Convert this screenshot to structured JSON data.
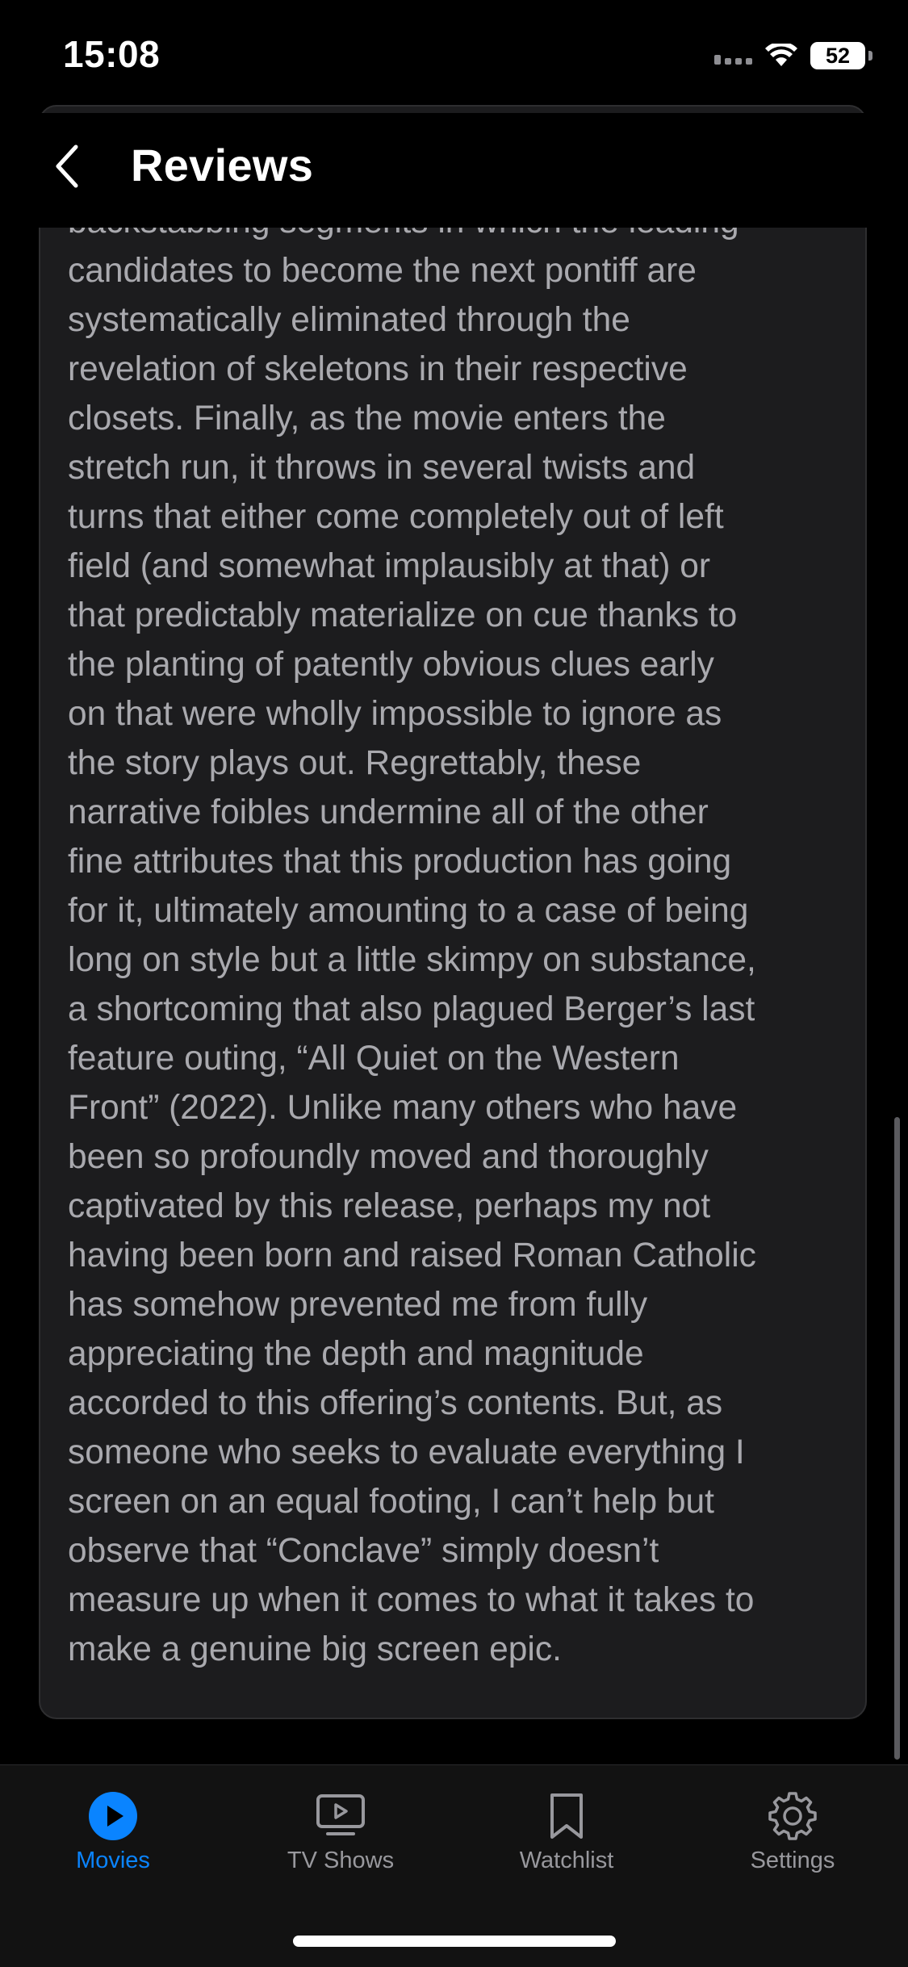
{
  "status_bar": {
    "time": "15:08",
    "battery": "52"
  },
  "header": {
    "title": "Reviews"
  },
  "review": {
    "lines": [
      "backstabbing segments in which the leading",
      "candidates to become the next pontiff are",
      "systematically eliminated through the",
      "revelation of skeletons in their respective",
      "closets. Finally, as the movie enters the",
      "stretch run, it throws in several twists and",
      "turns that either come completely out of left",
      "field (and somewhat implausibly at that) or",
      "that predictably materialize on cue thanks to",
      "the planting of patently obvious clues early",
      "on that were wholly impossible to ignore as",
      "the story plays out. Regrettably, these",
      "narrative foibles undermine all of the other",
      "fine attributes that this production has going",
      "for it, ultimately amounting to a case of being",
      "long on style but a little skimpy on substance,",
      "a shortcoming that also plagued Berger’s last",
      "feature outing, “All Quiet on the Western",
      "Front” (2022). Unlike many others who have",
      "been so profoundly moved and thoroughly",
      "captivated by this release, perhaps my not",
      "having been born and raised Roman Catholic",
      "has somehow prevented me from fully",
      "appreciating the depth and magnitude",
      "accorded to this offering’s contents. But, as",
      "someone who seeks to evaluate everything I",
      "screen on an equal footing, I can’t help but",
      "observe that “Conclave” simply doesn’t",
      "measure up when it comes to what it takes to",
      "make a genuine big screen epic."
    ]
  },
  "tabs": [
    {
      "label": "Movies",
      "icon": "play-circle-icon",
      "active": true
    },
    {
      "label": "TV Shows",
      "icon": "tv-play-icon",
      "active": false
    },
    {
      "label": "Watchlist",
      "icon": "bookmark-icon",
      "active": false
    },
    {
      "label": "Settings",
      "icon": "gear-icon",
      "active": false
    }
  ],
  "colors": {
    "accent": "#0a84ff",
    "card_background": "#1c1c1e",
    "body_text": "#a9a9ae",
    "inactive_tab": "#98989d"
  }
}
